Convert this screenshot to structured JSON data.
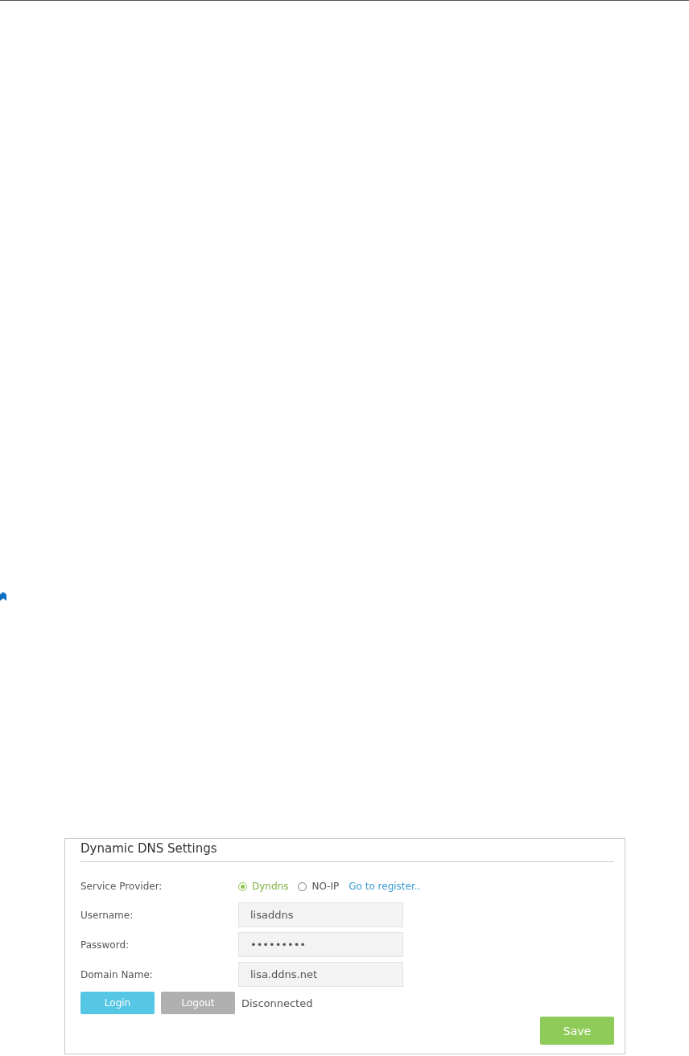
{
  "panel": {
    "title": "Dynamic DNS Settings",
    "service_provider": {
      "label": "Service Provider:",
      "options": [
        {
          "label": "Dyndns",
          "selected": true
        },
        {
          "label": "NO-IP",
          "selected": false
        }
      ],
      "link": "Go to register.."
    },
    "fields": [
      {
        "label": "Username:",
        "value": "lisaddns"
      },
      {
        "label": "Password:",
        "value": "•••••••••"
      },
      {
        "label": "Domain Name:",
        "value": "lisa.ddns.net"
      }
    ],
    "login_button": "Login",
    "logout_button": "Logout",
    "status": "Disconnected",
    "save_button": "Save"
  }
}
